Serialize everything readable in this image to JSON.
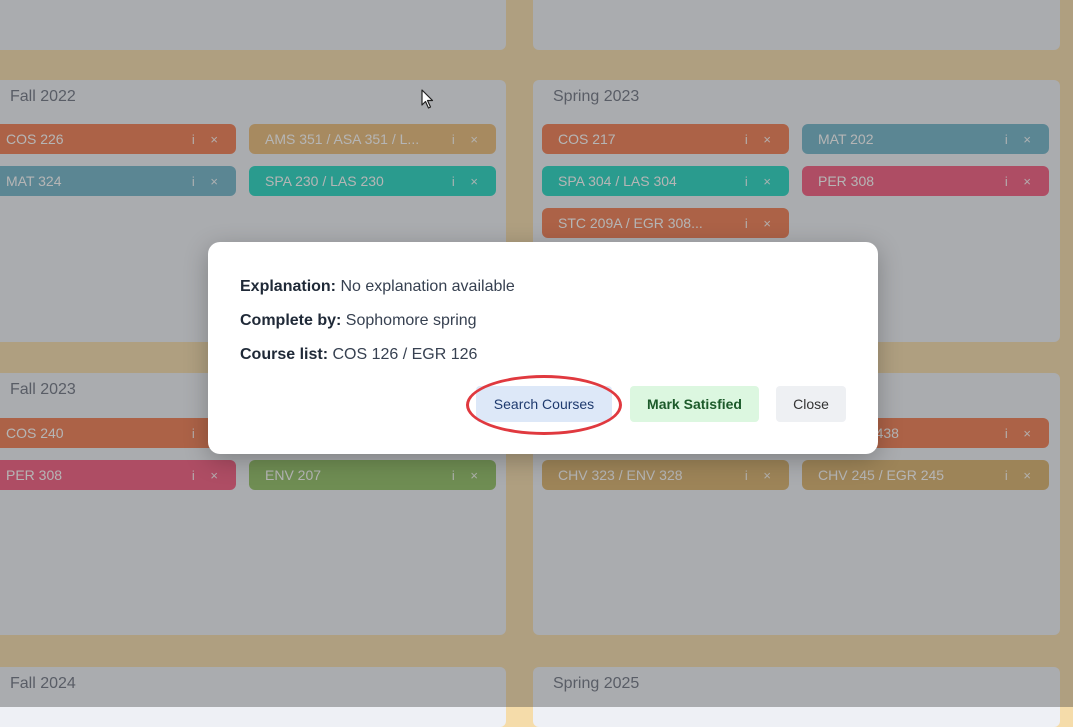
{
  "background": {
    "semesters": [
      {
        "title": "Fall 2022"
      },
      {
        "title": "Spring 2023"
      },
      {
        "title": "Fall 2023"
      },
      {
        "title": "Fall 2024"
      },
      {
        "title": "Spring 2025"
      }
    ],
    "courses": [
      {
        "label": "COS 226",
        "color": "#f07a4e"
      },
      {
        "label": "AMS 351 / ASA 351 / L...",
        "color": "#e9ba77"
      },
      {
        "label": "MAT 324",
        "color": "#6fb3c9"
      },
      {
        "label": "SPA 230 / LAS 230",
        "color": "#1fd6c0"
      },
      {
        "label": "COS 217",
        "color": "#f07a4e"
      },
      {
        "label": "MAT 202",
        "color": "#6fb3c9"
      },
      {
        "label": "SPA 304 / LAS 304",
        "color": "#1fd6c0"
      },
      {
        "label": "PER 308",
        "color": "#f4577d"
      },
      {
        "label": "STC 209A / EGR 308...",
        "color": "#f07a4e"
      },
      {
        "label": "COS 240",
        "color": "#f07a4e"
      },
      {
        "label": "PER 308",
        "color": "#f4577d"
      },
      {
        "label": "ENV 207",
        "color": "#8fbf62"
      },
      {
        "label": "... / EGR 438",
        "color": "#f07a4e"
      },
      {
        "label": "CHV 323 / ENV 328",
        "color": "#d9b06a"
      },
      {
        "label": "CHV 245 / EGR 245",
        "color": "#d9b06a"
      }
    ]
  },
  "modal": {
    "explanation_label": "Explanation:",
    "explanation_value": "No explanation available",
    "complete_by_label": "Complete by:",
    "complete_by_value": "Sophomore spring",
    "course_list_label": "Course list:",
    "course_list_value": "COS 126 / EGR 126",
    "search_label": "Search Courses",
    "mark_label": "Mark Satisfied",
    "close_label": "Close"
  }
}
